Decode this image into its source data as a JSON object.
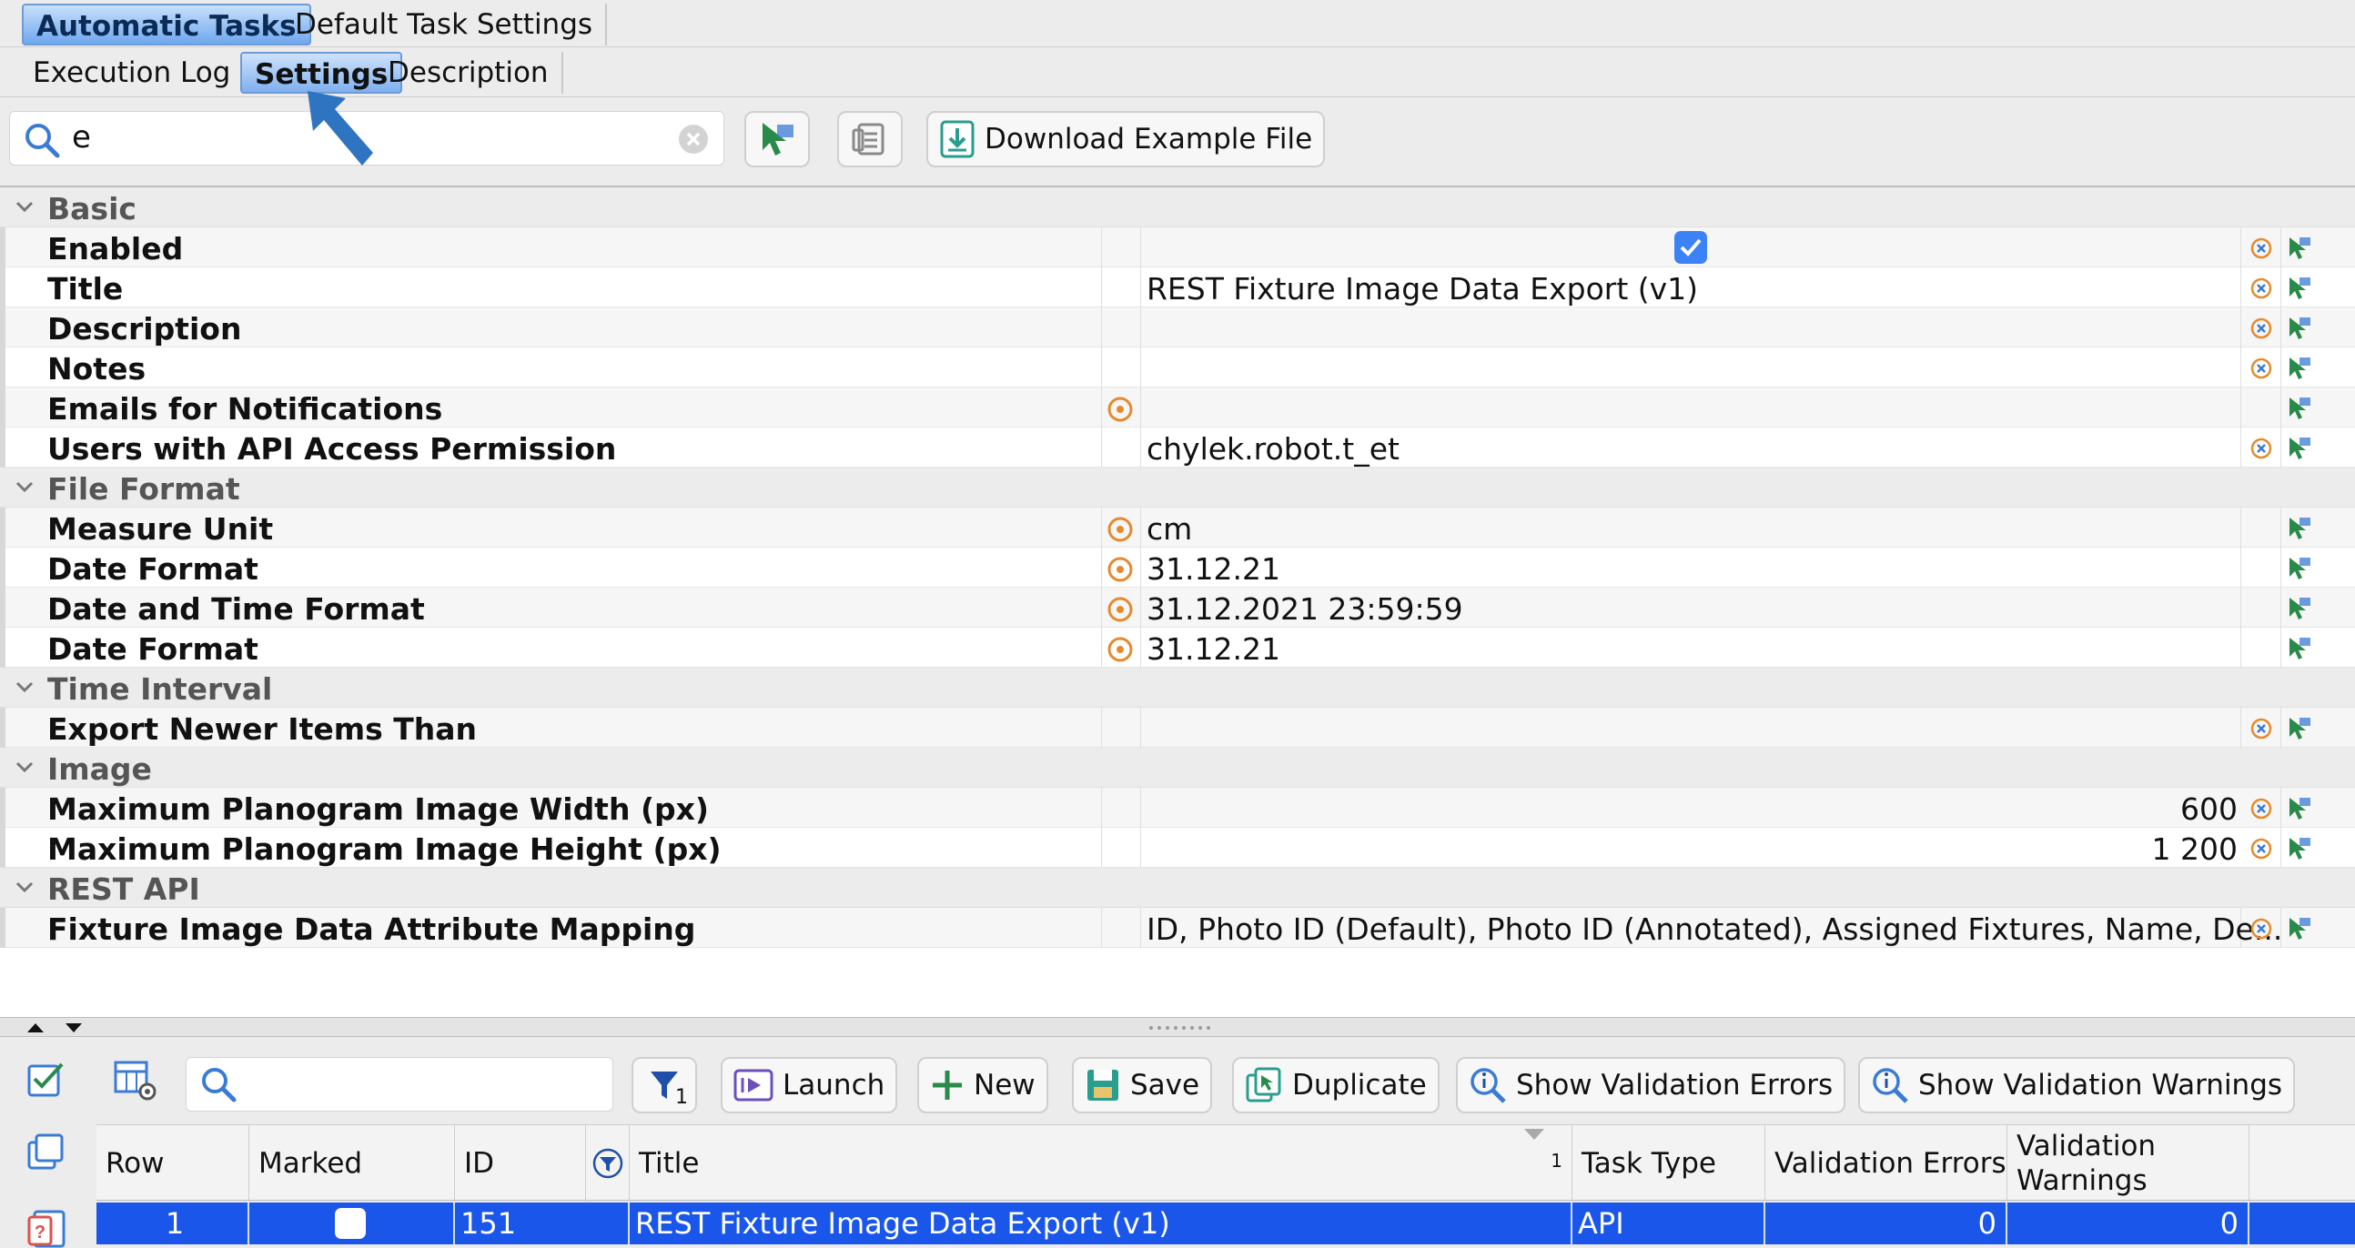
{
  "tabs_top": [
    "Automatic Tasks",
    "Default Task Settings"
  ],
  "tabs_sub": [
    "Execution Log",
    "Settings",
    "Description"
  ],
  "toolbar": {
    "search_value": "e",
    "download_label": "Download Example File"
  },
  "grid": {
    "groups": {
      "basic": "Basic",
      "file_format": "File Format",
      "time_interval": "Time Interval",
      "image": "Image",
      "rest_api": "REST API"
    },
    "rows": {
      "enabled": {
        "name": "Enabled",
        "checked": true
      },
      "title": {
        "name": "Title",
        "value": "REST Fixture Image Data Export (v1)"
      },
      "description": {
        "name": "Description",
        "value": ""
      },
      "notes": {
        "name": "Notes",
        "value": ""
      },
      "emails": {
        "name": "Emails for Notifications",
        "value": ""
      },
      "users_api": {
        "name": "Users with API Access Permission",
        "value": "chylek.robot.t_et"
      },
      "measure_unit": {
        "name": "Measure Unit",
        "value": "cm"
      },
      "date_format1": {
        "name": "Date Format",
        "value": "31.12.21"
      },
      "datetime_format": {
        "name": "Date and Time Format",
        "value": "31.12.2021 23:59:59"
      },
      "date_format2": {
        "name": "Date Format",
        "value": "31.12.21"
      },
      "export_newer": {
        "name": "Export Newer Items Than",
        "value": ""
      },
      "max_width": {
        "name": "Maximum Planogram Image Width (px)",
        "value": "600"
      },
      "max_height": {
        "name": "Maximum Planogram Image Height (px)",
        "value": "1 200"
      },
      "attr_mapping": {
        "name": "Fixture Image Data Attribute Mapping",
        "value": "ID, Photo ID (Default), Photo ID (Annotated), Assigned Fixtures, Name, De..."
      }
    }
  },
  "bottom": {
    "filter_badge": "1",
    "buttons": {
      "launch": "Launch",
      "new": "New",
      "save": "Save",
      "duplicate": "Duplicate",
      "show_errors": "Show Validation Errors",
      "show_warnings": "Show Validation Warnings"
    },
    "columns": {
      "row": "Row",
      "marked": "Marked",
      "id": "ID",
      "title": "Title",
      "title_sort_index": "1",
      "task_type": "Task Type",
      "validation_errors": "Validation Errors",
      "validation_warnings_1": "Validation",
      "validation_warnings_2": "Warnings"
    },
    "table_rows": [
      {
        "row": "1",
        "id": "151",
        "title": "REST Fixture Image Data Export (v1)",
        "task_type": "API",
        "errors": "0",
        "warnings": "0"
      }
    ]
  },
  "colors": {
    "selection": "#1a56ea",
    "accent_orange": "#e58a2e",
    "checkbox_blue": "#3b82f6"
  }
}
